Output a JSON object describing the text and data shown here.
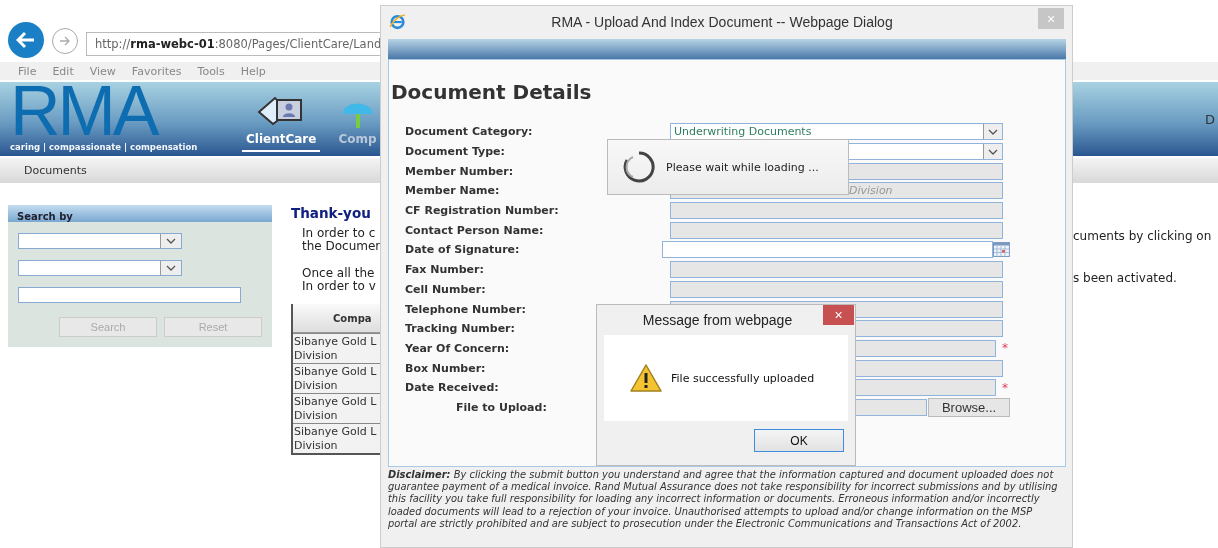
{
  "browser": {
    "address": "http://**rma-webc-01**:8080/Pages/ClientCare/Land",
    "menu": [
      "File",
      "Edit",
      "View",
      "Favorites",
      "Tools",
      "Help"
    ]
  },
  "banner": {
    "logo": "RMA",
    "tagline": "caring | compassionate | compensation",
    "nav": [
      {
        "label": "ClientCare",
        "selected": true
      },
      {
        "label": "Comp",
        "selected": false
      }
    ],
    "right_text": "D"
  },
  "subnav": [
    "Documents"
  ],
  "search_panel": {
    "title": "Search by",
    "fields": [
      {
        "kind": "select"
      },
      {
        "kind": "select"
      },
      {
        "kind": "text"
      }
    ],
    "buttons": [
      {
        "label": "Search",
        "disabled": true
      },
      {
        "label": "Reset",
        "disabled": true
      }
    ]
  },
  "content": {
    "heading": "Thank-you",
    "paragraphs": [
      [
        "In order to c",
        "the Documen"
      ],
      [
        "Once all the",
        "In order to v"
      ]
    ],
    "right_lines": [
      "cuments by clicking on",
      "s been activated."
    ],
    "table": {
      "columns": [
        "Compa"
      ],
      "rows": [
        {
          "lines": [
            "Sibanye Gold L",
            "Division"
          ]
        },
        {
          "lines": [
            "Sibanye Gold L",
            "Division"
          ]
        },
        {
          "lines": [
            "Sibanye Gold L",
            "Division"
          ]
        },
        {
          "lines": [
            "Sibanye Gold L",
            "Division"
          ]
        }
      ]
    }
  },
  "dialog": {
    "title": "RMA - Upload And Index Document -- Webpage Dialog",
    "close": "×",
    "heading": "Document Details",
    "fields": [
      {
        "label": "Document Category:",
        "kind": "select",
        "value": "Underwriting Documents",
        "disabled": false
      },
      {
        "label": "Document Type:",
        "kind": "select",
        "disabled": false
      },
      {
        "label": "Member Number:",
        "kind": "text",
        "disabled": true
      },
      {
        "label": "Member Name:",
        "kind": "text",
        "value": "Division",
        "disabled": true
      },
      {
        "label": "CF Registration Number:",
        "kind": "text",
        "disabled": true
      },
      {
        "label": "Contact Person Name:",
        "kind": "text",
        "disabled": true
      },
      {
        "label": "Date of Signature:",
        "kind": "date",
        "disabled": false
      },
      {
        "label": "Fax Number:",
        "kind": "text",
        "disabled": true
      },
      {
        "label": "Cell Number:",
        "kind": "text",
        "disabled": true
      },
      {
        "label": "Telephone Number:",
        "kind": "text",
        "disabled": true
      },
      {
        "label": "Tracking Number:",
        "kind": "text",
        "disabled": true
      },
      {
        "label": "Year Of Concern:",
        "kind": "text",
        "disabled": true,
        "required_mark": "*"
      },
      {
        "label": "Box Number:",
        "kind": "text",
        "disabled": true
      },
      {
        "label": "Date Received:",
        "kind": "text",
        "disabled": true,
        "required_mark": "*"
      },
      {
        "label": "File to Upload:",
        "kind": "file",
        "disabled": true,
        "button": "Browse..."
      }
    ],
    "disclaimer": "**Disclaimer:** By clicking the submit button you understand and agree that the information captured and document uploaded does not guarantee payment of a medical invoice. Rand Mutual Assurance does not take responsibility for incorrect submissions and by utilising this facility you take full responsibility for loading any incorrect information or documents. Erroneous information and/or incorrectly loaded documents will lead to a rejection of your invoice. Unauthorised attempts to upload and/or change information on the MSP portal are strictly prohibited and are subject to prosecution under the Electronic Communications and Transactions Act of 2002."
  },
  "loading": {
    "text": "Please wait while loading ..."
  },
  "message_box": {
    "title": "Message from webpage",
    "close": "×",
    "text": "File successfully uploaded",
    "buttons": [
      "OK"
    ]
  }
}
